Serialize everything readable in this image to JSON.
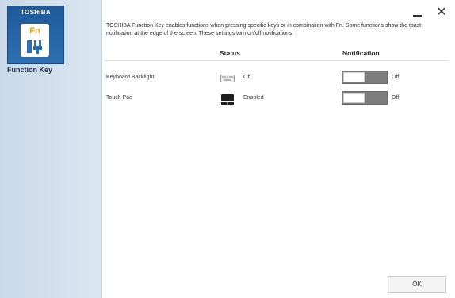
{
  "sidebar": {
    "brand": "TOSHIBA",
    "key_label": "Fn",
    "title": "Function Key"
  },
  "window": {
    "minimize_icon": "minimize-icon",
    "close_label": "✕"
  },
  "description": "TOSHIBA Function Key enables functions when pressing specific keys or in combination with Fn. Some functions show the toast notification at the edge of the screen. These settings turn on/off notifications.",
  "columns": {
    "status": "Status",
    "notification": "Notification"
  },
  "rows": [
    {
      "label": "Keyboard Backlight",
      "status_icon": "keyboard-icon",
      "status": "Off",
      "notification": "Off"
    },
    {
      "label": "Touch Pad",
      "status_icon": "touchpad-icon",
      "status": "Enabled",
      "notification": "Off"
    }
  ],
  "footer": {
    "ok_label": "OK"
  },
  "colors": {
    "sidebar": "#d3e1ee",
    "logo_tile": "#2562a4",
    "fn_accent": "#e9a315",
    "toggle_off": "#7c7c7c"
  }
}
